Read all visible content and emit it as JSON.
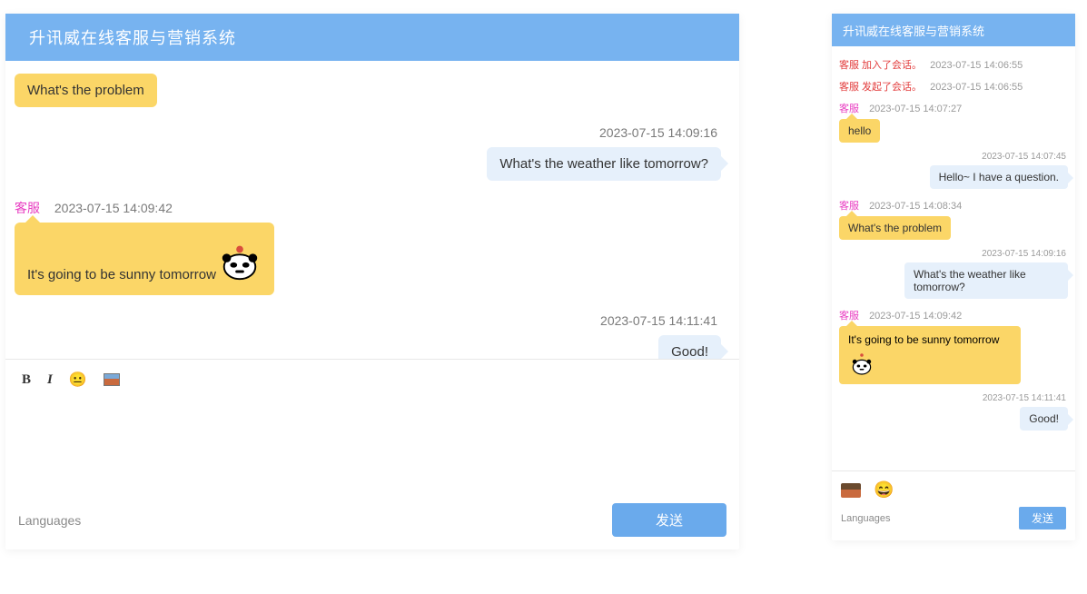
{
  "left": {
    "title": "升讯威在线客服与营销系统",
    "messages": [
      {
        "side": "agent",
        "text": "What's the problem",
        "ts": "",
        "sender": ""
      },
      {
        "side": "visitor",
        "text": "What's the weather like tomorrow?",
        "ts": "2023-07-15 14:09:16"
      },
      {
        "side": "agent",
        "text": "It's going to be sunny tomorrow",
        "ts": "2023-07-15 14:09:42",
        "sender": "客服",
        "hasPanda": true
      },
      {
        "side": "visitor",
        "text": "Good!",
        "ts": "2023-07-15 14:11:41"
      }
    ],
    "toolbar": {
      "bold": "B",
      "italic": "I"
    },
    "languages": "Languages",
    "sendLabel": "发送"
  },
  "right": {
    "title": "升讯威在线客服与营销系统",
    "system": [
      {
        "label": "客服 加入了会话。",
        "ts": "2023-07-15 14:06:55"
      },
      {
        "label": "客服 发起了会话。",
        "ts": "2023-07-15 14:06:55"
      }
    ],
    "messages": [
      {
        "side": "agent",
        "text": "hello",
        "ts": "2023-07-15 14:07:27",
        "sender": "客服"
      },
      {
        "side": "visitor",
        "text": "Hello~  I have a question.",
        "ts": "2023-07-15 14:07:45"
      },
      {
        "side": "agent",
        "text": "What's the problem",
        "ts": "2023-07-15 14:08:34",
        "sender": "客服"
      },
      {
        "side": "visitor",
        "text": "What's the weather like tomorrow?",
        "ts": "2023-07-15 14:09:16"
      },
      {
        "side": "agent",
        "text": "It's going to be sunny tomorrow",
        "ts": "2023-07-15 14:09:42",
        "sender": "客服",
        "hasPanda": true
      },
      {
        "side": "visitor",
        "text": "Good!",
        "ts": "2023-07-15 14:11:41"
      }
    ],
    "languages": "Languages",
    "sendLabel": "发送"
  }
}
